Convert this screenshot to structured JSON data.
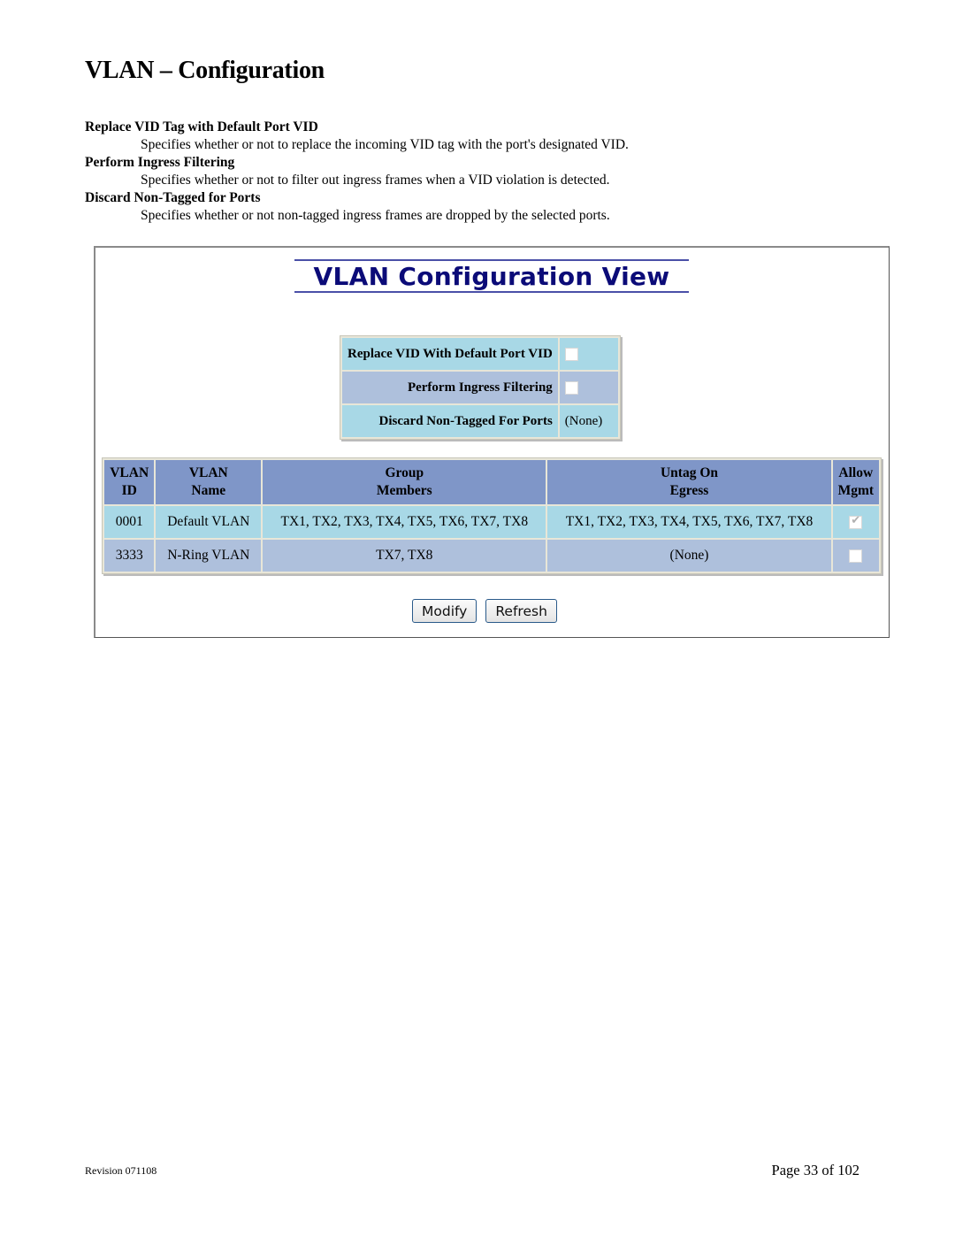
{
  "page": {
    "title": "VLAN – Configuration"
  },
  "definitions": [
    {
      "term": "Replace VID Tag with Default Port VID",
      "description": "Specifies whether or not to replace the incoming VID tag with the port's designated VID."
    },
    {
      "term": "Perform Ingress Filtering",
      "description": "Specifies whether or not to filter out ingress frames when a VID violation is detected."
    },
    {
      "term": "Discard Non-Tagged for Ports",
      "description": "Specifies whether or not non-tagged ingress frames are dropped by the selected ports."
    }
  ],
  "view": {
    "title": "VLAN Configuration View",
    "settings": [
      {
        "label": "Replace VID With Default Port VID",
        "type": "checkbox",
        "checked": false
      },
      {
        "label": "Perform Ingress Filtering",
        "type": "checkbox",
        "checked": false
      },
      {
        "label": "Discard Non-Tagged For Ports",
        "type": "text",
        "value": "(None)"
      }
    ],
    "table": {
      "headers": [
        {
          "line1": "VLAN",
          "line2": "ID"
        },
        {
          "line1": "VLAN",
          "line2": "Name"
        },
        {
          "line1": "Group",
          "line2": "Members"
        },
        {
          "line1": "Untag On",
          "line2": "Egress"
        },
        {
          "line1": "Allow",
          "line2": "Mgmt"
        }
      ],
      "rows": [
        {
          "id": "0001",
          "name": "Default VLAN",
          "members": "TX1, TX2, TX3, TX4, TX5, TX6, TX7, TX8",
          "untag": "TX1, TX2, TX3, TX4, TX5, TX6, TX7, TX8",
          "allow_mgmt": true
        },
        {
          "id": "3333",
          "name": "N-Ring VLAN",
          "members": "TX7, TX8",
          "untag": "(None)",
          "allow_mgmt": false
        }
      ]
    },
    "buttons": {
      "modify": "Modify",
      "refresh": "Refresh"
    }
  },
  "footer": {
    "revision": "Revision 071108",
    "page": "Page 33 of 102"
  }
}
